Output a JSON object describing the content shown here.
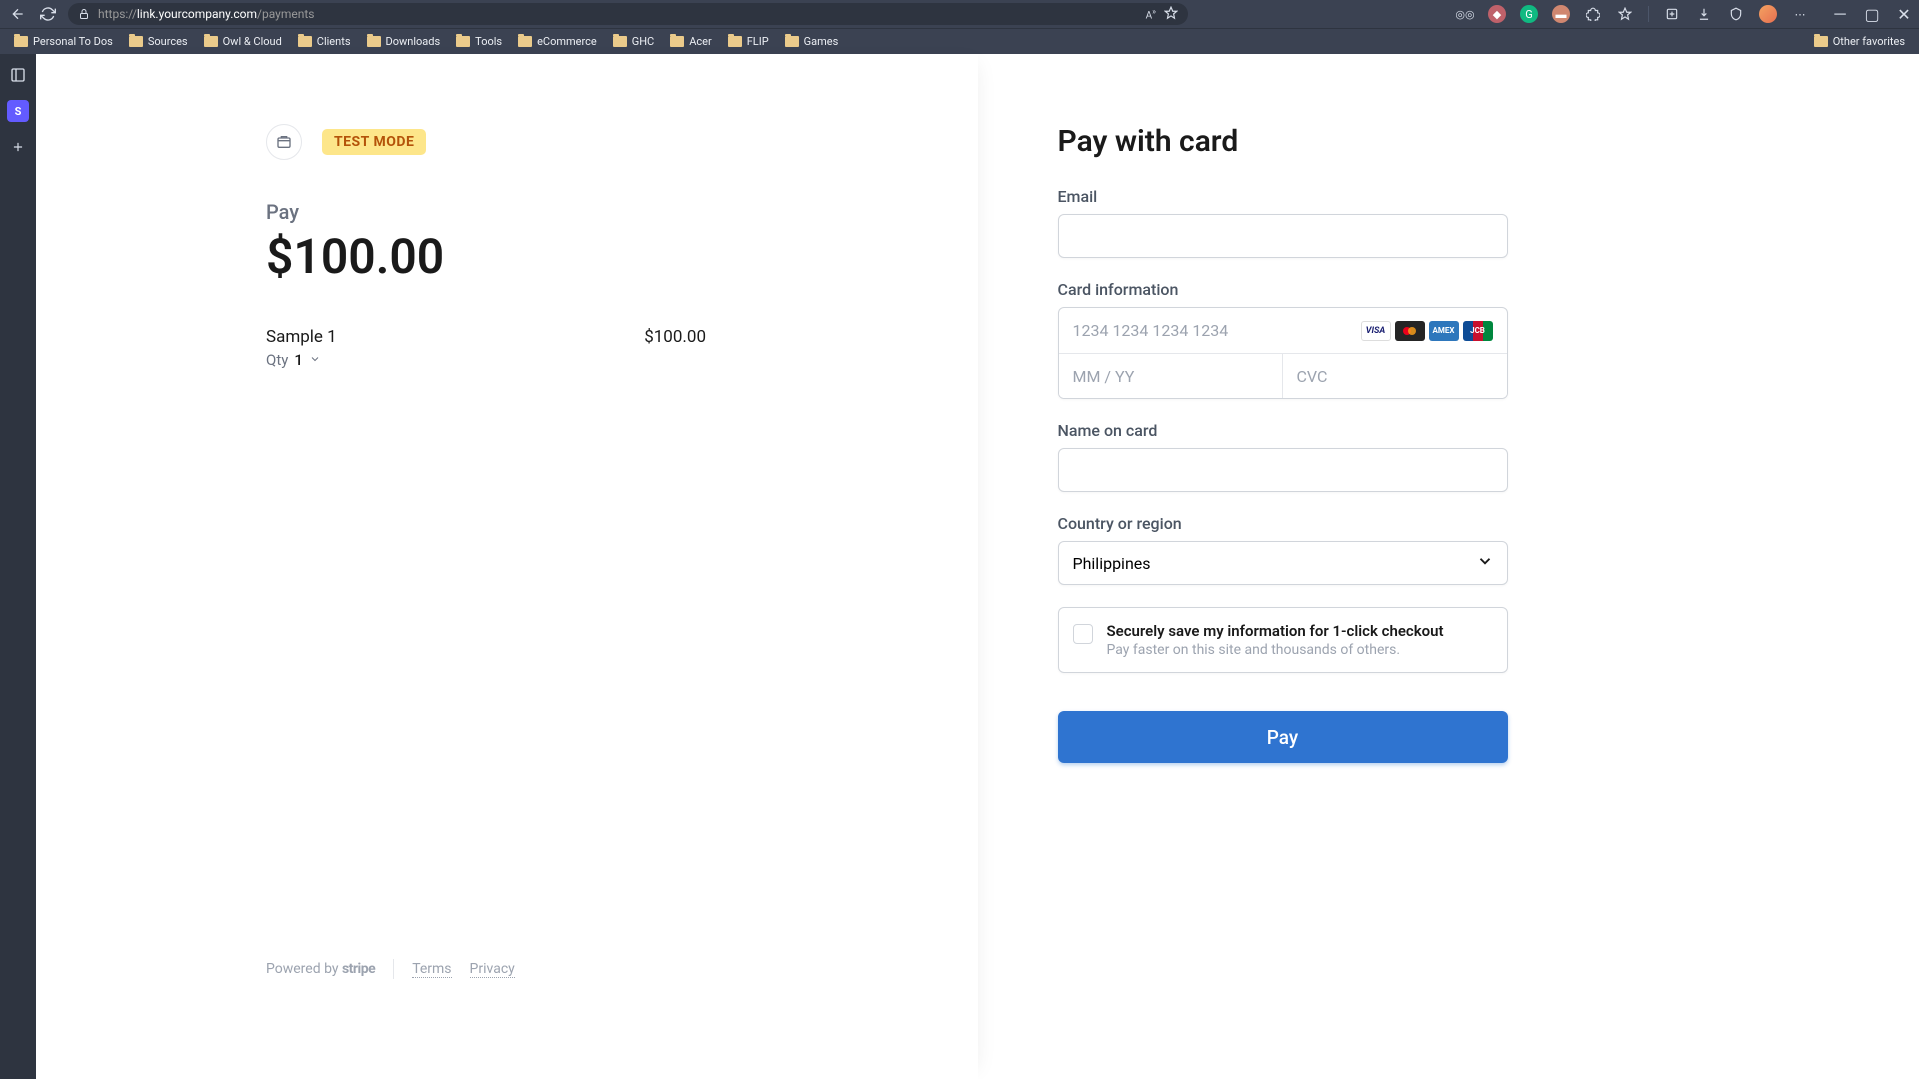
{
  "browser": {
    "url_prefix": "https://",
    "url_domain": "link.yourcompany.com",
    "url_path": "/payments",
    "bookmarks": [
      "Personal To Dos",
      "Sources",
      "Owl & Cloud",
      "Clients",
      "Downloads",
      "Tools",
      "eCommerce",
      "GHC",
      "Acer",
      "FLIP",
      "Games"
    ],
    "other_favorites": "Other favorites",
    "sidebar_letter": "S"
  },
  "checkout": {
    "test_badge": "TEST MODE",
    "pay_label": "Pay",
    "amount": "$100.00",
    "line_item_name": "Sample 1",
    "line_item_price": "$100.00",
    "qty_label": "Qty",
    "qty_value": "1",
    "powered_by": "Powered by",
    "stripe": "stripe",
    "terms": "Terms",
    "privacy": "Privacy"
  },
  "form": {
    "title": "Pay with card",
    "email_label": "Email",
    "card_label": "Card information",
    "card_placeholder": "1234 1234 1234 1234",
    "expiry_placeholder": "MM / YY",
    "cvc_placeholder": "CVC",
    "name_label": "Name on card",
    "country_label": "Country or region",
    "country_value": "Philippines",
    "save_title": "Securely save my information for 1-click checkout",
    "save_sub": "Pay faster on this site and thousands of others.",
    "pay_button": "Pay",
    "brands": {
      "visa": "VISA",
      "amex": "AMEX",
      "jcb": "JCB"
    }
  }
}
